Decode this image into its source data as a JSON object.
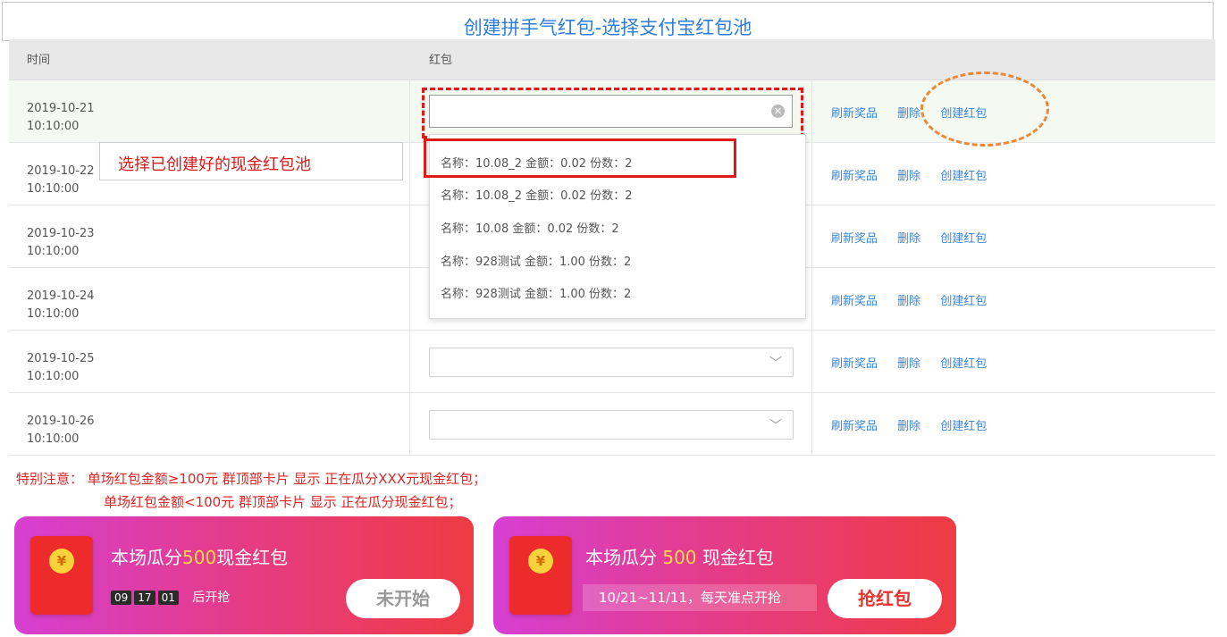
{
  "title": "创建拼手气红包-选择支付宝红包池",
  "table": {
    "headers": {
      "time": "时间",
      "redpacket": "红包"
    },
    "rows": [
      {
        "date": "2019-10-21",
        "time": "10:10:00"
      },
      {
        "date": "2019-10-22",
        "time": "10:10:00"
      },
      {
        "date": "2019-10-23",
        "time": "10:10:00"
      },
      {
        "date": "2019-10-24",
        "time": "10:10:00"
      },
      {
        "date": "2019-10-25",
        "time": "10:10:00"
      },
      {
        "date": "2019-10-26",
        "time": "10:10:00"
      }
    ],
    "actions": {
      "refresh": "刷新奖品",
      "delete": "删除",
      "create": "创建红包"
    }
  },
  "dropdown": {
    "options": [
      "名称：10.08_2 金额：0.02 份数：2",
      "名称：10.08_2 金额：0.02 份数：2",
      "名称：10.08 金额：0.02 份数：2",
      "名称：928测试 金额：1.00 份数：2",
      "名称：928测试 金额：1.00 份数：2"
    ]
  },
  "callout": "选择已创建好的现金红包池",
  "notes": {
    "line1": "特别注意：  单场红包金额≥100元 群顶部卡片 显示 正在瓜分XXX元现金红包；",
    "line2": "单场红包金额<100元 群顶部卡片 显示 正在瓜分现金红包；"
  },
  "card1": {
    "headline_pre": "本场瓜分",
    "amount": "500",
    "headline_post": "现金红包",
    "timer": [
      "09",
      "17",
      "01"
    ],
    "timer_suffix": "后开抢",
    "button": "未开始",
    "coin": "¥"
  },
  "card2": {
    "headline_pre": "本场瓜分 ",
    "amount": "500",
    "headline_post": " 现金红包",
    "date_range": "10/21~11/11，每天准点开抢",
    "button": "抢红包",
    "coin": "¥"
  },
  "colors": {
    "title_blue": "#2f7ddb",
    "action_blue": "#3b86d8",
    "alert_red": "#e01a1a",
    "highlight_orange": "#e88a3a"
  }
}
